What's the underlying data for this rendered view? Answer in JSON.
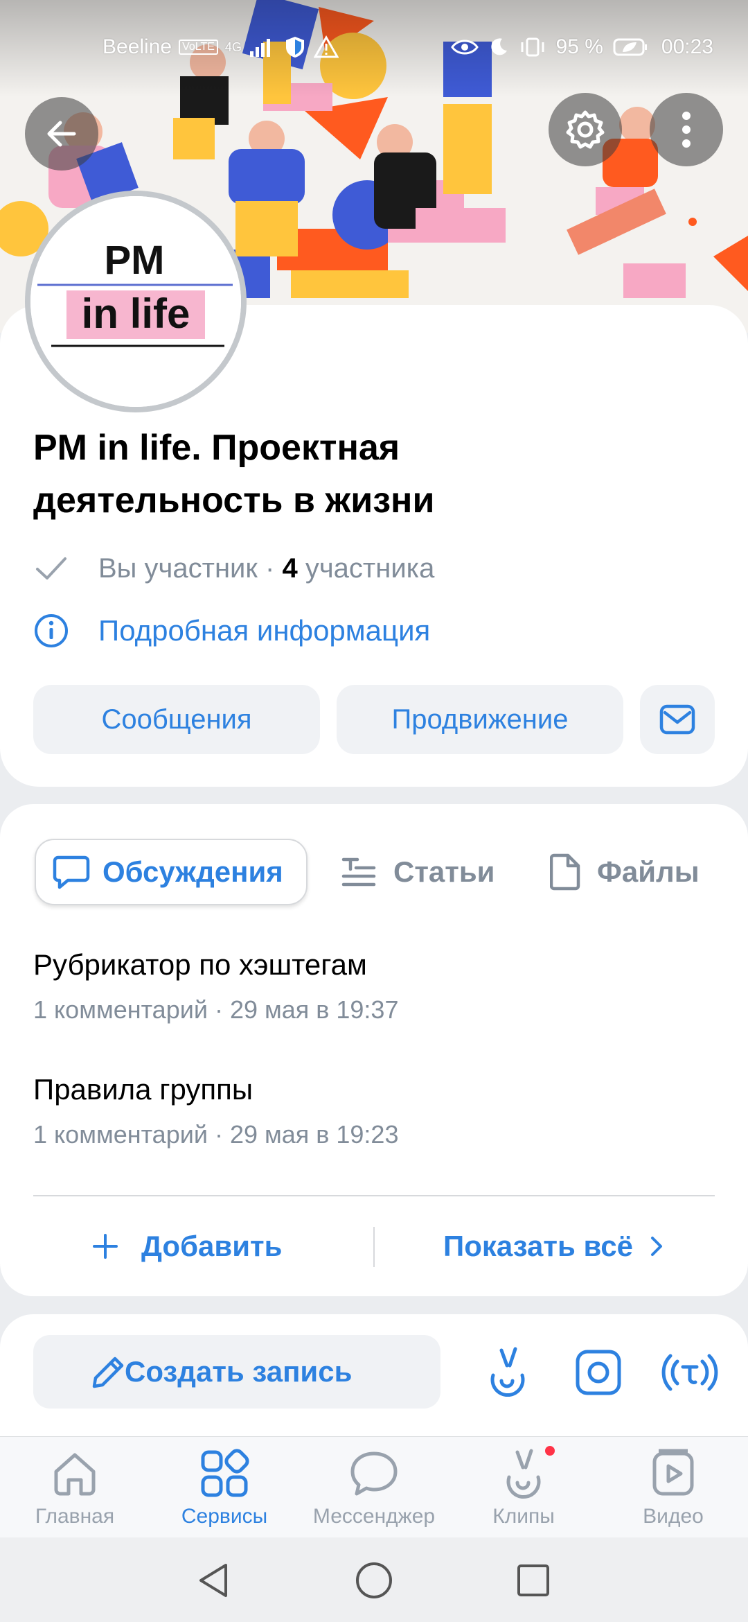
{
  "status_bar": {
    "carrier": "Beeline",
    "volte": "VoLTE",
    "network": "4G",
    "battery": "95 %",
    "time": "00:23"
  },
  "cover": {
    "back_icon": "arrow-left-icon",
    "settings_icon": "gear-icon",
    "more_icon": "more-vertical-icon"
  },
  "avatar": {
    "line1": "PM",
    "line2": "in life"
  },
  "group": {
    "title": "PM in life. Проектная деятельность в жизни",
    "membership": "Вы участник",
    "separator": "·",
    "members_count": "4",
    "members_label": "участника",
    "info_link": "Подробная информация"
  },
  "actions": {
    "messages": "Сообщения",
    "promotion": "Продвижение",
    "mail_icon": "mail-icon"
  },
  "tabs": {
    "discussions": "Обсуждения",
    "articles": "Статьи",
    "files": "Файлы"
  },
  "topics": [
    {
      "title": "Рубрикатор по хэштегам",
      "meta": "1 комментарий · 29 мая в 19:37"
    },
    {
      "title": "Правила группы",
      "meta": "1 комментарий · 29 мая в 19:23"
    }
  ],
  "discussion_footer": {
    "add": "Добавить",
    "show_all": "Показать всё"
  },
  "post": {
    "create": "Создать запись"
  },
  "bottom_nav": [
    {
      "label": "Главная",
      "icon": "home-icon"
    },
    {
      "label": "Сервисы",
      "icon": "services-icon"
    },
    {
      "label": "Мессенджер",
      "icon": "messenger-icon"
    },
    {
      "label": "Клипы",
      "icon": "clips-icon"
    },
    {
      "label": "Видео",
      "icon": "video-icon"
    }
  ],
  "colors": {
    "accent": "#2d81e0",
    "secondary_text": "#818c99",
    "badge": "#ff3347"
  }
}
